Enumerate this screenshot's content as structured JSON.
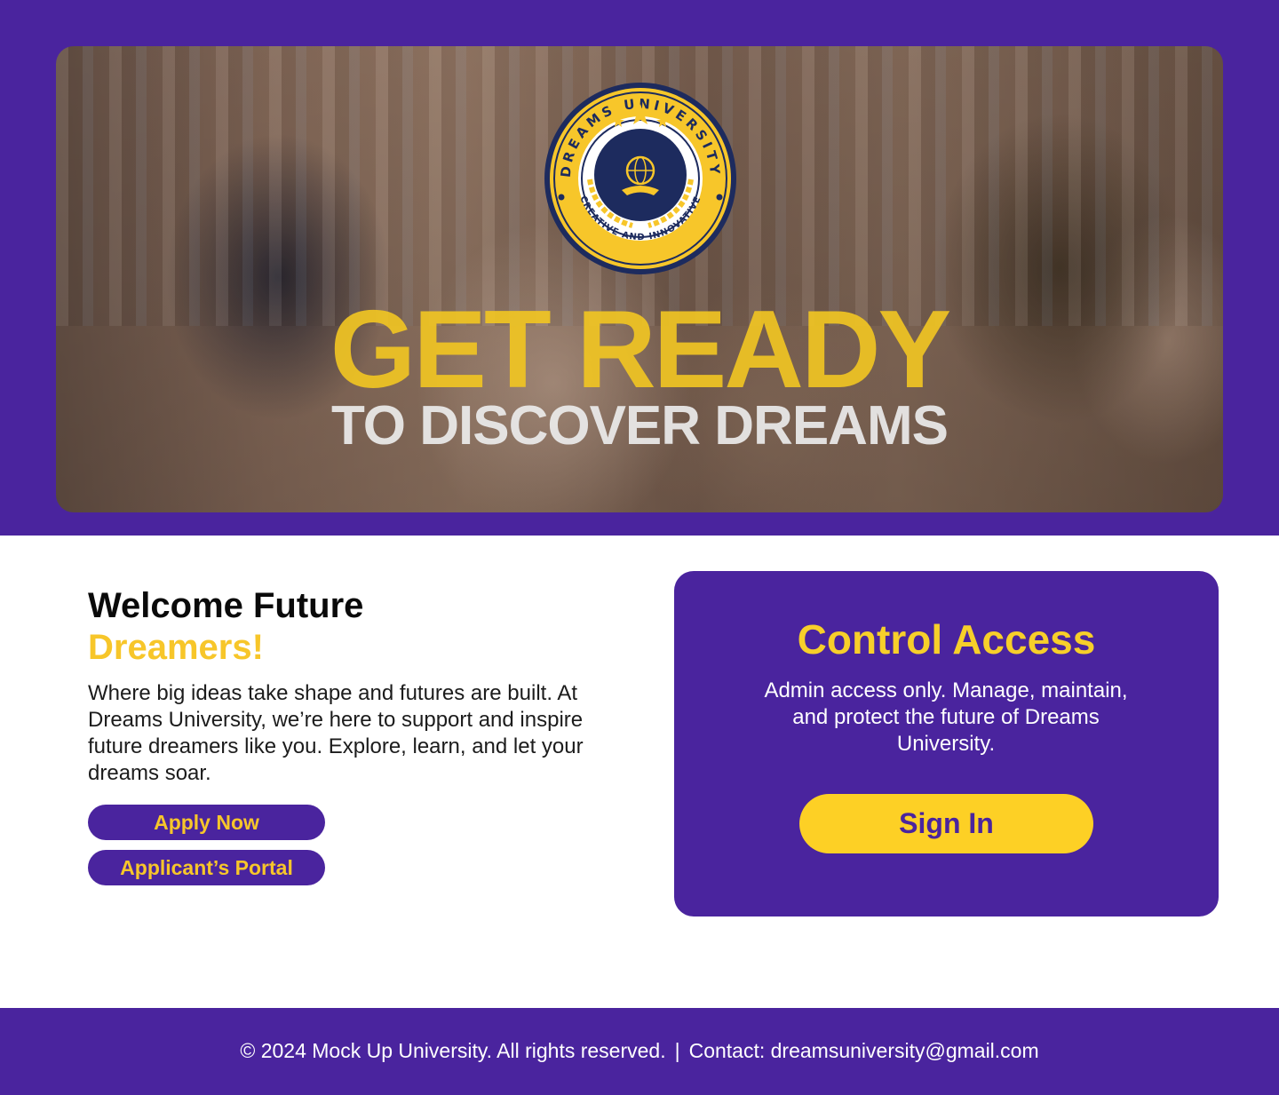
{
  "hero": {
    "seal": {
      "top_text": "DREAMS UNIVERSITY",
      "bottom_text": "CREATIVE AND INNOVATIVE"
    },
    "title": "GET READY",
    "subtitle": "TO DISCOVER DREAMS"
  },
  "welcome": {
    "line1": "Welcome Future",
    "line2": "Dreamers!",
    "body": "Where big ideas take shape and futures are built. At Dreams University, we’re here to support and inspire future dreamers like you. Explore, learn, and let your dreams soar.",
    "apply_label": "Apply Now",
    "portal_label": "Applicant’s Portal"
  },
  "admin": {
    "title": "Control Access",
    "body": "Admin access only. Manage, maintain, and protect the future of Dreams University.",
    "signin_label": "Sign In"
  },
  "footer": {
    "copyright": "© 2024 Mock Up University. All rights reserved.",
    "separator": "|",
    "contact": "Contact: dreamsuniversity@gmail.com"
  },
  "colors": {
    "primary": "#4a249e",
    "accent": "#f7c62a",
    "button_yellow": "#fdd025"
  }
}
